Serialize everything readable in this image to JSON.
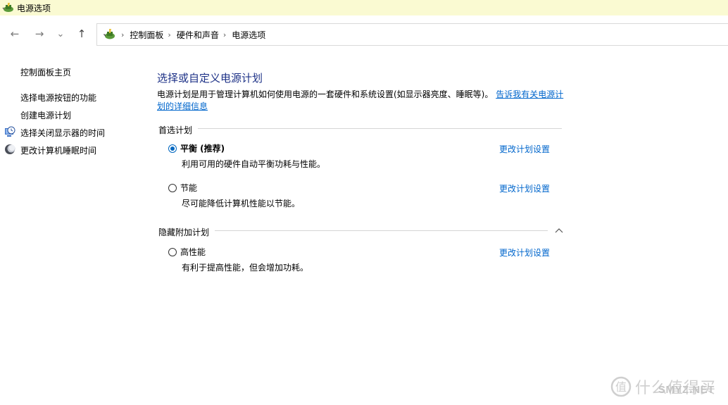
{
  "window": {
    "title": "电源选项",
    "app_icon": "power-options-icon"
  },
  "nav": {
    "back_glyph": "←",
    "forward_glyph": "→",
    "recent_glyph": "⌄",
    "up_glyph": "↑",
    "breadcrumbs": [
      "控制面板",
      "硬件和声音",
      "电源选项"
    ],
    "separator": "›"
  },
  "sidebar": {
    "home": "控制面板主页",
    "items": [
      {
        "label": "选择电源按钮的功能",
        "icon": null
      },
      {
        "label": "创建电源计划",
        "icon": null
      },
      {
        "label": "选择关闭显示器的时间",
        "icon": "clock-monitor-icon"
      },
      {
        "label": "更改计算机睡眠时间",
        "icon": "moon-icon"
      }
    ]
  },
  "main": {
    "heading": "选择或自定义电源计划",
    "description": "电源计划是用于管理计算机如何使用电源的一套硬件和系统设置(如显示器亮度、睡眠等)。",
    "description_link": "告诉我有关电源计划的详细信息",
    "preferred_section": "首选计划",
    "hidden_section": "隐藏附加计划",
    "change_link": "更改计划设置",
    "plans": [
      {
        "name": "平衡 (推荐)",
        "desc": "利用可用的硬件自动平衡功耗与性能。",
        "selected": true
      },
      {
        "name": "节能",
        "desc": "尽可能降低计算机性能以节能。",
        "selected": false
      },
      {
        "name": "高性能",
        "desc": "有利于提高性能，但会增加功耗。",
        "selected": false
      }
    ]
  },
  "watermark": {
    "brand": "什么值得买",
    "site": "SMYZ.NET"
  },
  "colors": {
    "titlebar_bg": "#fafad2",
    "heading": "#1e3287",
    "link": "#0066cc",
    "radio_accent": "#0067c0"
  }
}
